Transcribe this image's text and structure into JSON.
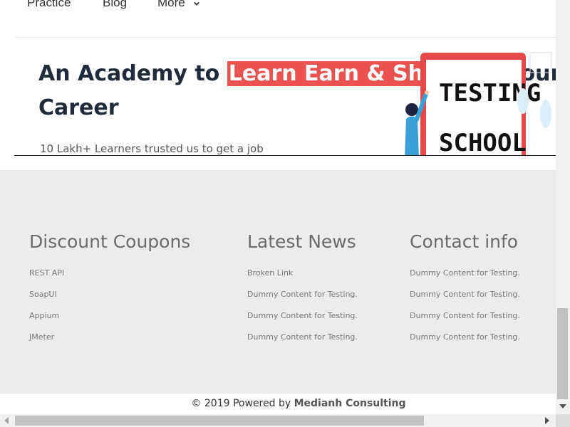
{
  "nav": {
    "items": [
      "Practice",
      "Blog",
      "More"
    ]
  },
  "hero": {
    "title_before": "An Academy to ",
    "title_highlight": "Learn Earn & Shine",
    "title_after": "  in your QA",
    "title_line2": "Career",
    "subtitle": "10 Lakh+ Learners trusted us to get a job",
    "image_text_line1": "TESTING",
    "image_text_line2": "SCHOOL"
  },
  "footer": {
    "columns": [
      {
        "title": "Discount Coupons",
        "links": [
          "REST API",
          "SoapUI",
          "Appium",
          "JMeter"
        ]
      },
      {
        "title": "Latest News",
        "links": [
          "Broken Link",
          "Dummy Content for Testing.",
          "Dummy Content for Testing.",
          "Dummy Content for Testing."
        ]
      },
      {
        "title": "Contact info",
        "links": [
          "Dummy Content for Testing.",
          "Dummy Content for Testing.",
          "Dummy Content for Testing.",
          "Dummy Content for Testing."
        ]
      }
    ],
    "copyright_prefix": "© 2019 Powered by ",
    "copyright_brand": "Medianh Consulting"
  },
  "colors": {
    "highlight": "#e9524f",
    "heading": "#1f2b3a",
    "footer_bg": "#ececec"
  }
}
